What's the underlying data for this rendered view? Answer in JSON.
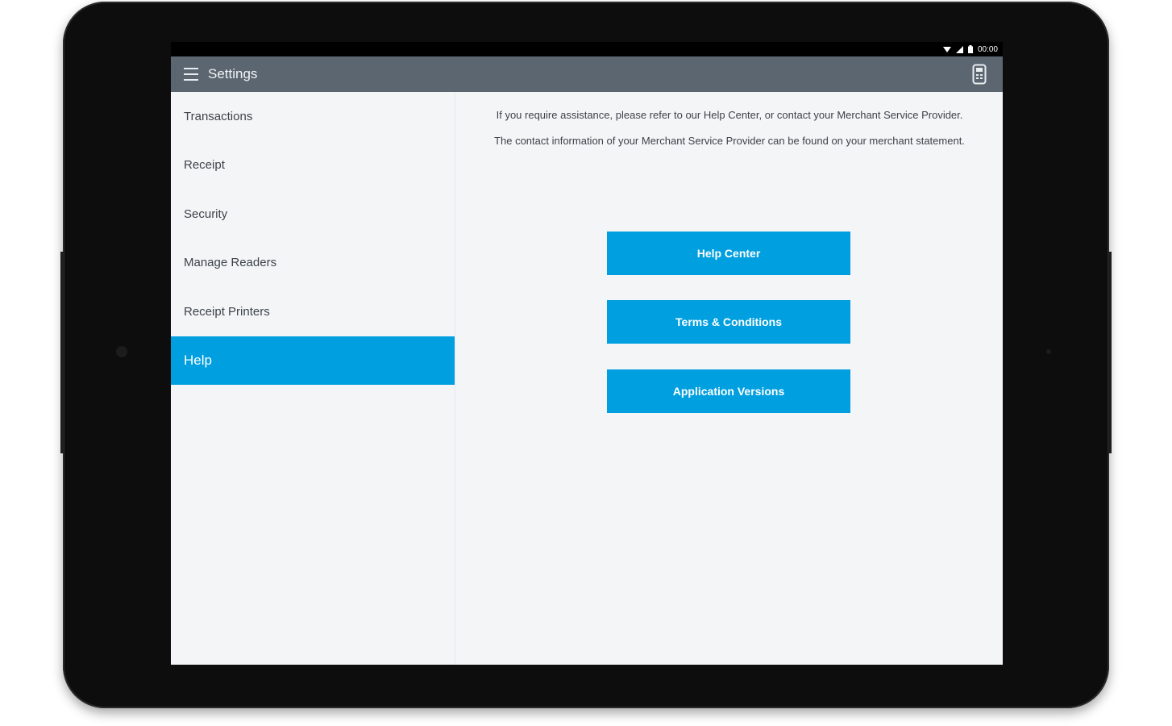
{
  "status_bar": {
    "time": "00:00",
    "icons": [
      "wifi-icon",
      "signal-icon",
      "battery-icon"
    ]
  },
  "app_bar": {
    "title": "Settings",
    "menu_icon": "hamburger-menu-icon",
    "action_icon": "card-reader-icon"
  },
  "sidebar": {
    "items": [
      {
        "label": "Transactions",
        "active": false
      },
      {
        "label": "Receipt",
        "active": false
      },
      {
        "label": "Security",
        "active": false
      },
      {
        "label": "Manage Readers",
        "active": false
      },
      {
        "label": "Receipt Printers",
        "active": false
      },
      {
        "label": "Help",
        "active": true
      }
    ]
  },
  "help": {
    "info_1": "If you require assistance, please refer to our Help Center, or contact your Merchant Service Provider.",
    "info_2": "The contact information of your Merchant Service Provider can be found on your merchant statement.",
    "buttons": {
      "help_center": "Help Center",
      "terms": "Terms & Conditions",
      "versions": "Application Versions"
    }
  },
  "colors": {
    "accent": "#009fdf",
    "app_bar": "#5b6671",
    "background": "#f3f5f7",
    "text": "#3d434a"
  }
}
